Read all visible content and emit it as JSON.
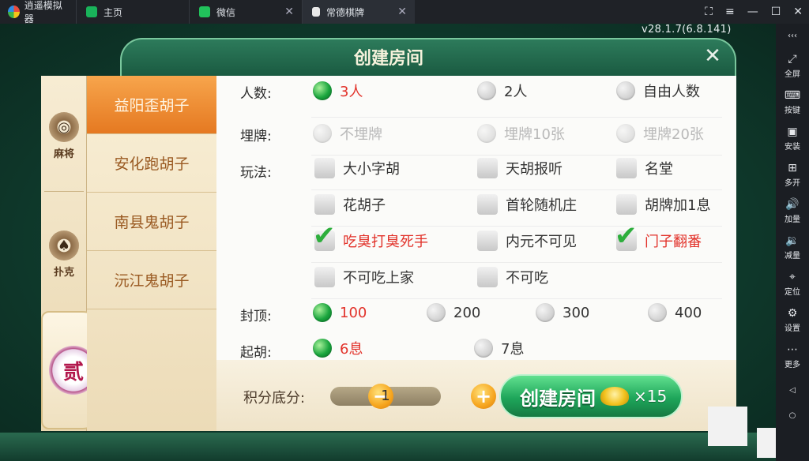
{
  "titlebar": {
    "app_name": "逍遥模拟器",
    "tabs": [
      {
        "label": "主页",
        "icon": "home-app-icon",
        "color": "#19b35a"
      },
      {
        "label": "微信",
        "icon": "wechat-icon",
        "color": "#21c25b"
      },
      {
        "label": "常德棋牌",
        "icon": "lock-icon",
        "color": "#e9e9e9"
      }
    ],
    "close_glyph": "✕"
  },
  "version": "v28.1.7(6.8.141)",
  "sidebar": {
    "items": [
      {
        "label": "全屏",
        "icon": "fullscreen-icon",
        "glyph": "⤢"
      },
      {
        "label": "按键",
        "icon": "keyboard-icon",
        "glyph": "⌨"
      },
      {
        "label": "安装",
        "icon": "apk-icon",
        "glyph": "▣"
      },
      {
        "label": "多开",
        "icon": "multi-open-icon",
        "glyph": "⊞"
      },
      {
        "label": "加量",
        "icon": "volume-up-icon",
        "glyph": "🔊"
      },
      {
        "label": "减量",
        "icon": "volume-down-icon",
        "glyph": "🔉"
      },
      {
        "label": "定位",
        "icon": "location-icon",
        "glyph": "⌖"
      },
      {
        "label": "设置",
        "icon": "settings-icon",
        "glyph": "⚙"
      },
      {
        "label": "更多",
        "icon": "more-icon",
        "glyph": "⋯"
      }
    ],
    "top_glyph": "‹‹‹",
    "back_glyph": "◁",
    "home_glyph": "○"
  },
  "dialog": {
    "title": "创建房间",
    "close_glyph": "✕",
    "categories": [
      {
        "label": "麻将",
        "glyph": "◎"
      },
      {
        "label": "扑克",
        "glyph": "♠"
      }
    ],
    "special_medal": "贰",
    "games": [
      "益阳歪胡子",
      "安化跑胡子",
      "南县鬼胡子",
      "沅江鬼胡子"
    ],
    "active_game_index": 0,
    "labels": {
      "players": "人数:",
      "bury": "埋牌:",
      "rules": "玩法:",
      "cap": "封顶:",
      "start": "起胡:"
    },
    "players": [
      "3人",
      "2人",
      "自由人数"
    ],
    "bury": [
      "不埋牌",
      "埋牌10张",
      "埋牌20张"
    ],
    "rules": [
      "大小字胡",
      "天胡报听",
      "名堂",
      "花胡子",
      "首轮随机庄",
      "胡牌加1息",
      "吃臭打臭死手",
      "内元不可见",
      "门子翻番",
      "不可吃上家",
      "不可吃"
    ],
    "rules_checked": [
      "吃臭打臭死手",
      "门子翻番"
    ],
    "cap": [
      "100",
      "200",
      "300",
      "400"
    ],
    "start": [
      "6息",
      "7息"
    ],
    "selected": {
      "players": "3人",
      "cap": "100",
      "start": "6息"
    },
    "score": {
      "label": "积分底分:",
      "value": "1",
      "minus": "−",
      "plus": "+"
    },
    "create_button": {
      "label": "创建房间",
      "cost": "×15"
    },
    "colors": {
      "accent_orange": "#e57921",
      "selected_red": "#e2322a",
      "green": "#1ea65a"
    }
  }
}
